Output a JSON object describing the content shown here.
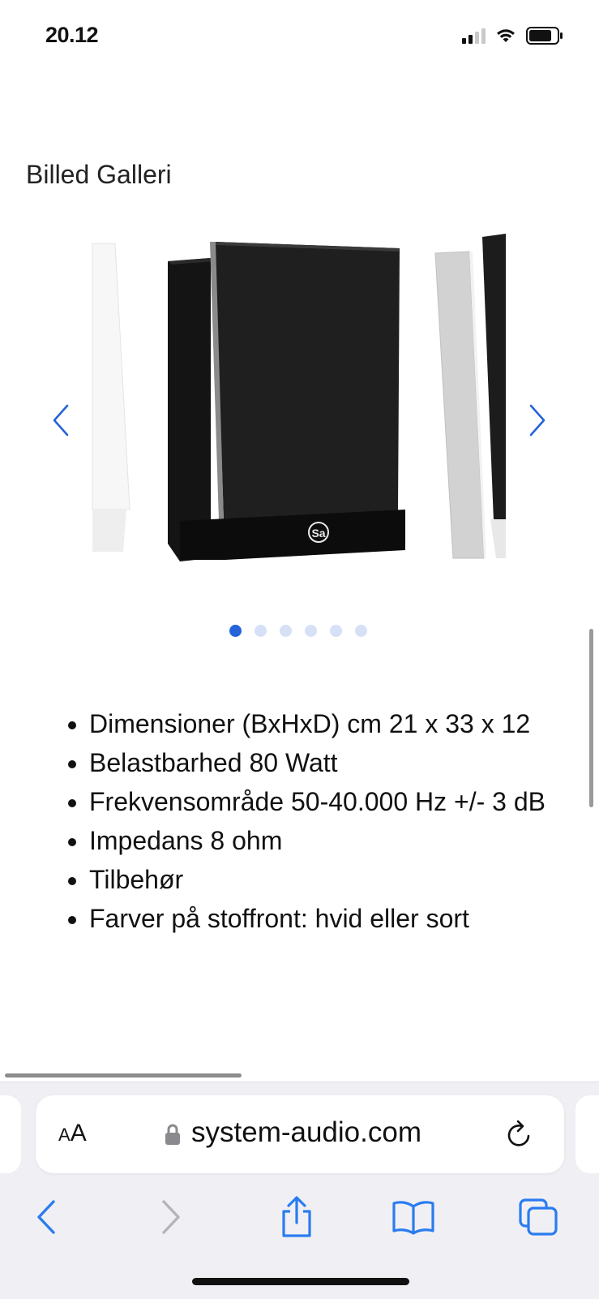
{
  "status": {
    "time": "20.12"
  },
  "gallery": {
    "title": "Billed Galleri",
    "slide_count": 6,
    "active_index": 0,
    "logo_text": "Sa"
  },
  "specs": [
    "Dimensioner (BxHxD) cm 21 x 33 x 12",
    "Belastbarhed 80 Watt",
    "Frekvensområde 50-40.000 Hz +/- 3 dB",
    "Impedans 8 ohm",
    "Tilbehør",
    "Farver på stoffront: hvid eller sort"
  ],
  "browser": {
    "text_size_label_small": "A",
    "text_size_label_large": "A",
    "url": "system-audio.com"
  },
  "colors": {
    "accent": "#2563d9",
    "dot_inactive": "#d6e0f7",
    "chrome_bg": "#f0f0f4"
  }
}
